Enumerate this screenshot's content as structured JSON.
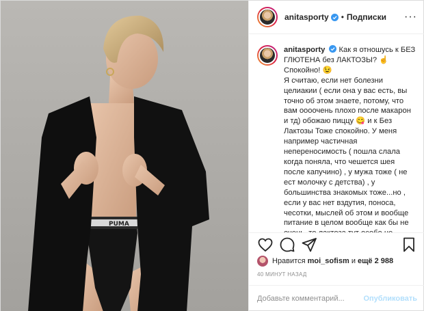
{
  "post": {
    "username": "anitasporty",
    "separator": "•",
    "follow_label": "Подписки",
    "more_label": "···"
  },
  "caption": {
    "username": "anitasporty",
    "text": "Как я отношусь к БЕЗ ГЛЮТЕНА без ЛАКТОЗЫ? ☝️\nСпокойно! 😉\nЯ считаю, если нет болезни целиакии ( если она у вас есть, вы точно об этом знаете, потому, что вам оооочень плохо после макарон и тд) обожаю пиццу 😋 и к Без Лактозы Тоже спокойно. У меня например частичная непереносимость ( пошла слала когда поняла, что чешется шея после капучино) , у мужа тоже ( не ест молочку с детства) , у большинства знакомых тоже...но , если у вас нет вздутия, поноса, чесотки, мыслей об этом и вообще питание в целом вообще как бы не очень, то лактоза тут особо не поможет. Если молоко заходит на ура . то и пейте 😱"
  },
  "icons": {
    "like": "heart-icon",
    "comment": "comment-bubble-icon",
    "share": "paper-plane-icon",
    "save": "bookmark-icon",
    "verified": "verified-badge-icon"
  },
  "likes": {
    "prefix": "Нравится",
    "user": "moi_sofism",
    "middle": "и",
    "count_text": "ещё 2 988"
  },
  "timestamp": "40 МИНУТ НАЗАД",
  "comment": {
    "placeholder": "Добавьте комментарий...",
    "publish_label": "Опубликовать"
  },
  "photo": {
    "brand_text": "PUMA"
  },
  "colors": {
    "verified": "#3897f0",
    "publish_disabled": "#b2dffc",
    "muted": "#8e8e8e"
  }
}
